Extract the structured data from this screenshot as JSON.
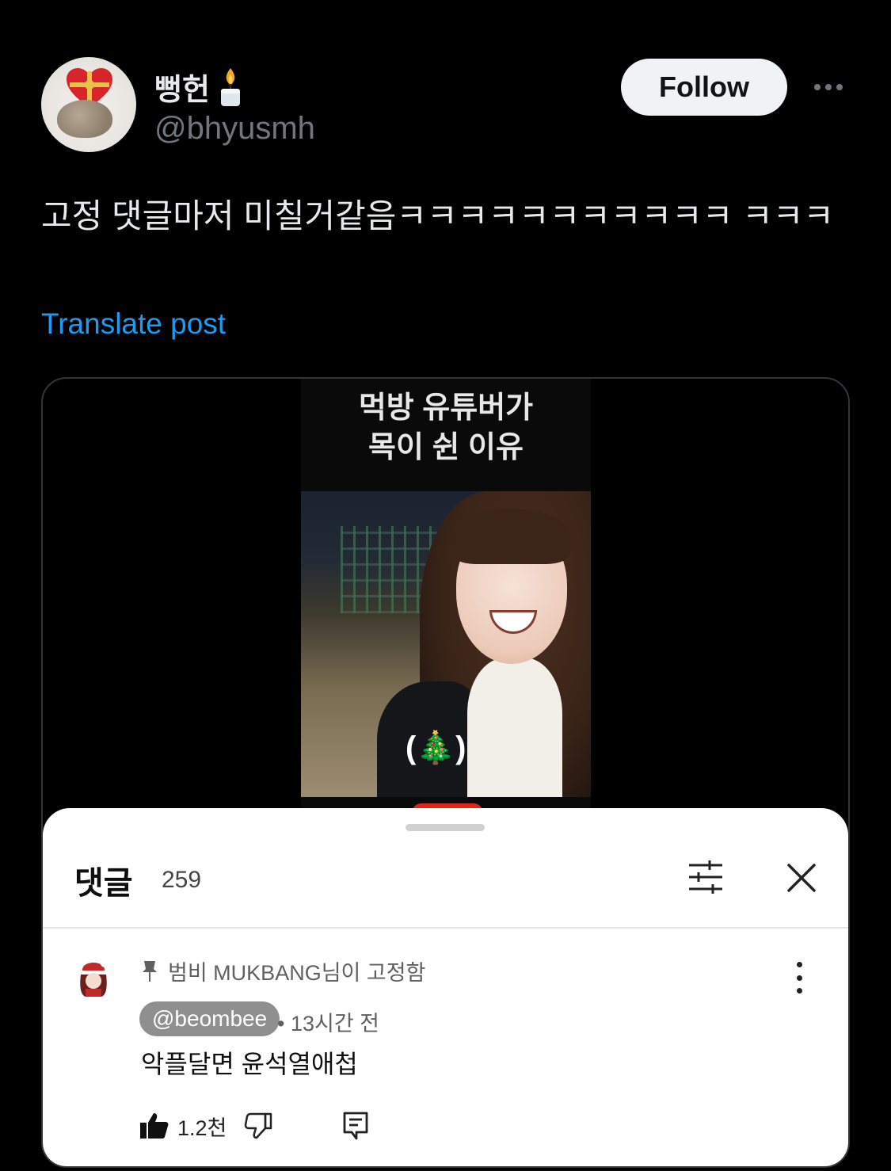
{
  "author": {
    "display_name": "뻥헌",
    "name_emoji": "🕯️",
    "handle": "@bhyusmh"
  },
  "follow_label": "Follow",
  "post": {
    "text": "고정 댓글마저 미칠거같음ㅋㅋㅋㅋㅋㅋㅋㅋㅋㅋㅋ ㅋㅋㅋ",
    "translate_label": "Translate post"
  },
  "video": {
    "caption_line1": "먹방 유튜버가",
    "caption_line2": "목이 쉰 이유",
    "overlay": "(🎄)"
  },
  "comments_sheet": {
    "title": "댓글",
    "count": "259",
    "pinned_label": "범비 MUKBANG님이 고정함",
    "comment": {
      "author": "@beombee",
      "time": "• 13시간 전",
      "text": "악플달면 윤석열애첩",
      "likes": "1.2천"
    }
  },
  "colors": {
    "background": "#000000",
    "link_blue": "#1d9bf0",
    "handle_gray": "#71767b",
    "follow_bg": "#eff3f4"
  }
}
